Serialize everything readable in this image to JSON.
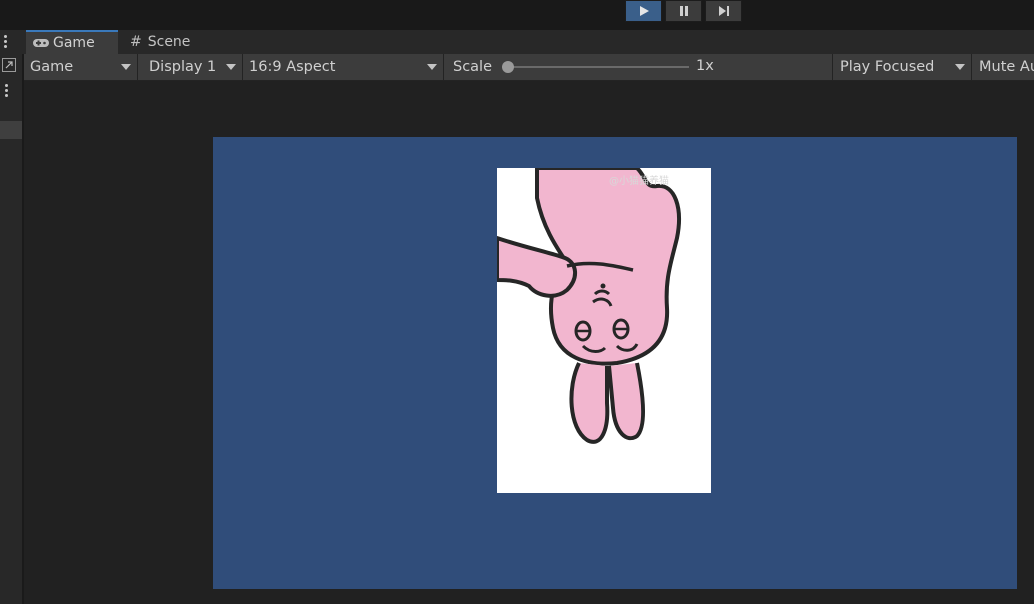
{
  "playbar": {
    "play_icon": "play-icon",
    "pause_icon": "pause-icon",
    "step_icon": "step-icon"
  },
  "tabs": [
    {
      "label": "Game",
      "icon": "gamepad-icon",
      "selected": true
    },
    {
      "label": "Scene",
      "icon": "hash-icon",
      "selected": false
    }
  ],
  "toolbar": {
    "game_select": "Game",
    "display_select": "Display 1",
    "aspect_select": "16:9 Aspect",
    "scale_label": "Scale",
    "scale_value": "1x",
    "scale_level": 0,
    "play_mode_select": "Play Focused",
    "mute_label": "Mute Au"
  },
  "viewport": {
    "background_color": "#304d7a",
    "sprite_description": "upside-down pink bunny sticker",
    "watermark": "@小猫猫养猫"
  },
  "colors": {
    "accent": "#3a79bb",
    "play_active": "#3a5f8a",
    "bunny_pink": "#f2b6cf"
  }
}
